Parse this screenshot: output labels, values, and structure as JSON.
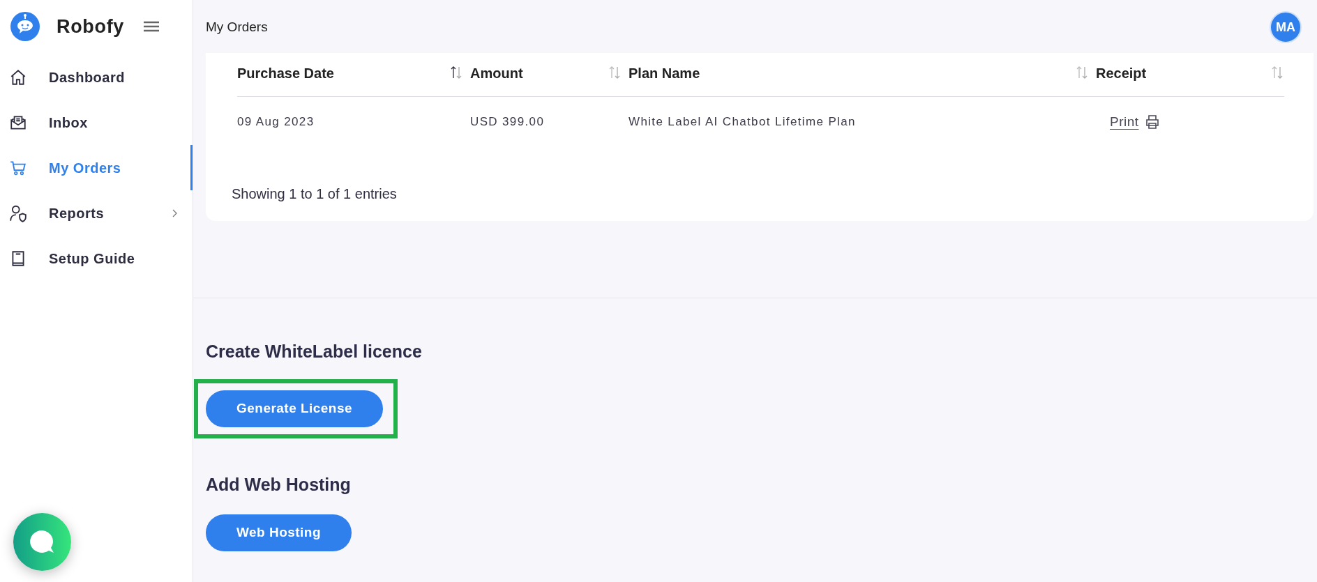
{
  "brand": {
    "name": "Robofy"
  },
  "sidebar": {
    "items": [
      {
        "label": "Dashboard",
        "kind": "home",
        "selected": false,
        "has_submenu": false
      },
      {
        "label": "Inbox",
        "kind": "mail",
        "selected": false,
        "has_submenu": false
      },
      {
        "label": "My Orders",
        "kind": "cart",
        "selected": true,
        "has_submenu": false
      },
      {
        "label": "Reports",
        "kind": "reports",
        "selected": false,
        "has_submenu": true
      },
      {
        "label": "Setup Guide",
        "kind": "book",
        "selected": false,
        "has_submenu": false
      }
    ]
  },
  "header": {
    "title": "My Orders",
    "avatar": "MA"
  },
  "table": {
    "columns": [
      {
        "label": "Purchase Date",
        "sorted": true
      },
      {
        "label": "Amount",
        "sorted": false
      },
      {
        "label": "Plan Name",
        "sorted": false
      },
      {
        "label": "Receipt",
        "sorted": false
      }
    ],
    "rows": [
      {
        "cells": [
          "09 Aug 2023",
          "USD 399.00",
          "White Label AI Chatbot Lifetime Plan"
        ],
        "receipt_link": "Print"
      }
    ],
    "info": "Showing 1 to 1 of 1 entries"
  },
  "sections": [
    {
      "heading": "Create WhiteLabel licence",
      "button": "Generate License",
      "highlighted": true
    },
    {
      "heading": "Add Web Hosting",
      "button": "Web Hosting",
      "highlighted": false
    }
  ]
}
